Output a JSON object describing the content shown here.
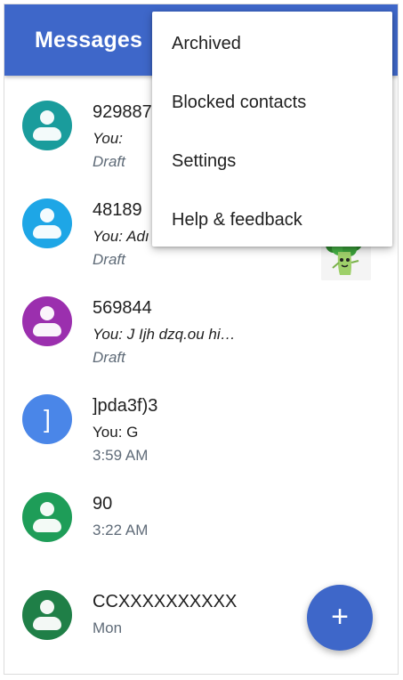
{
  "appbar": {
    "title": "Messages",
    "color": "#3e67c9"
  },
  "menu": {
    "items": [
      {
        "label": "Archived"
      },
      {
        "label": "Blocked contacts"
      },
      {
        "label": "Settings"
      },
      {
        "label": "Help & feedback"
      }
    ]
  },
  "conversations": [
    {
      "name": "929887",
      "snippet": "You:",
      "meta": "Draft",
      "avatar_color": "#1a9c9c",
      "avatar_icon": "person-icon"
    },
    {
      "name": "48189",
      "snippet": "You: Adı",
      "meta": "Draft",
      "avatar_color": "#1ea6e6",
      "avatar_icon": "person-icon"
    },
    {
      "name": "569844",
      "snippet": "You: J Ijh dzq.ou hi…",
      "meta": "Draft",
      "avatar_color": "#9b2fae",
      "avatar_icon": "person-icon",
      "attachment_icon": "broccoli-sticker-icon"
    },
    {
      "name": "]pda3f)3",
      "snippet": "You: G",
      "meta": "3:59 AM",
      "avatar_color": "#4a86e8",
      "avatar_letter": "]"
    },
    {
      "name": "90",
      "snippet": "",
      "meta": "3:22 AM",
      "avatar_color": "#1e9d58",
      "avatar_icon": "person-icon"
    },
    {
      "name": "CCXXXXXXXXXX",
      "snippet": "",
      "meta": "Mon",
      "avatar_color": "#1f7f47",
      "avatar_icon": "person-icon"
    }
  ],
  "fab": {
    "icon": "plus-icon",
    "symbol": "+"
  }
}
